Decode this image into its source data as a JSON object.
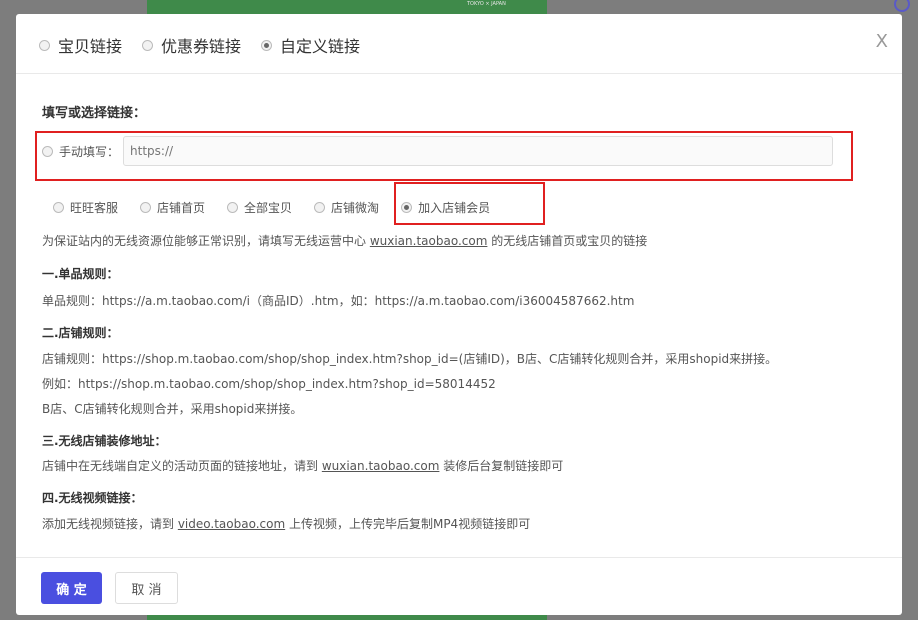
{
  "background": {
    "strip_text": "TOKYO × JAPAN"
  },
  "header": {
    "tabs": [
      {
        "label": "宝贝链接",
        "checked": false
      },
      {
        "label": "优惠券链接",
        "checked": false
      },
      {
        "label": "自定义链接",
        "checked": true
      }
    ],
    "close_glyph": "X"
  },
  "form": {
    "section_title": "填写或选择链接：",
    "manual_label": "手动填写：",
    "url_placeholder": "https://",
    "options": [
      {
        "label": "旺旺客服",
        "checked": false
      },
      {
        "label": "店铺首页",
        "checked": false
      },
      {
        "label": "全部宝贝",
        "checked": false
      },
      {
        "label": "店铺微淘",
        "checked": false
      },
      {
        "label": "加入店铺会员",
        "checked": true
      }
    ]
  },
  "notes": {
    "intro_pre": "为保证站内的无线资源位能够正常识别，请填写无线运营中心 ",
    "intro_link": "wuxian.taobao.com",
    "intro_post": " 的无线店铺首页或宝贝的链接",
    "rule1_title": "一.单品规则：",
    "rule1_text": "单品规则：https://a.m.taobao.com/i（商品ID）.htm，如：https://a.m.taobao.com/i36004587662.htm",
    "rule2_title": "二.店铺规则：",
    "rule2_text1": "店铺规则：https://shop.m.taobao.com/shop/shop_index.htm?shop_id=(店铺ID)，B店、C店铺转化规则合并，采用shopid来拼接。",
    "rule2_text2": "例如：https://shop.m.taobao.com/shop/shop_index.htm?shop_id=58014452",
    "rule2_text3": "B店、C店铺转化规则合并，采用shopid来拼接。",
    "rule3_title": "三.无线店铺装修地址：",
    "rule3_pre": "店铺中在无线端自定义的活动页面的链接地址，请到 ",
    "rule3_link": "wuxian.taobao.com",
    "rule3_post": " 装修后台复制链接即可",
    "rule4_title": "四.无线视频链接：",
    "rule4_pre": "添加无线视频链接，请到 ",
    "rule4_link": "video.taobao.com",
    "rule4_post": " 上传视频，上传完毕后复制MP4视频链接即可"
  },
  "footer": {
    "ok_label": "确 定",
    "cancel_label": "取 消"
  },
  "colors": {
    "primary": "#4a4fe0",
    "highlight": "#e02020"
  }
}
